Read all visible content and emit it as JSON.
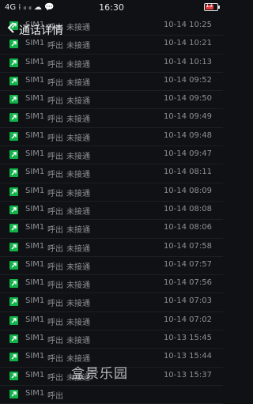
{
  "statusbar": {
    "left_text": "4G ⁞ ᵢₗ ᵢₗ ☁ 💬",
    "time": "16:30",
    "battery": "13"
  },
  "header": {
    "title": "通话详情"
  },
  "rows": [
    {
      "sim": "SIM1",
      "type": "呼出",
      "status": "未接通",
      "time": "10-14 10:25"
    },
    {
      "sim": "SIM1",
      "type": "呼出",
      "status": "未接通",
      "time": "10-14 10:21"
    },
    {
      "sim": "SIM1",
      "type": "呼出",
      "status": "未接通",
      "time": "10-14 10:13"
    },
    {
      "sim": "SIM1",
      "type": "呼出",
      "status": "未接通",
      "time": "10-14 09:52"
    },
    {
      "sim": "SIM1",
      "type": "呼出",
      "status": "未接通",
      "time": "10-14 09:50"
    },
    {
      "sim": "SIM1",
      "type": "呼出",
      "status": "未接通",
      "time": "10-14 09:49"
    },
    {
      "sim": "SIM1",
      "type": "呼出",
      "status": "未接通",
      "time": "10-14 09:48"
    },
    {
      "sim": "SIM1",
      "type": "呼出",
      "status": "未接通",
      "time": "10-14 09:47"
    },
    {
      "sim": "SIM1",
      "type": "呼出",
      "status": "未接通",
      "time": "10-14 08:11"
    },
    {
      "sim": "SIM1",
      "type": "呼出",
      "status": "未接通",
      "time": "10-14 08:09"
    },
    {
      "sim": "SIM1",
      "type": "呼出",
      "status": "未接通",
      "time": "10-14 08:08"
    },
    {
      "sim": "SIM1",
      "type": "呼出",
      "status": "未接通",
      "time": "10-14 08:06"
    },
    {
      "sim": "SIM1",
      "type": "呼出",
      "status": "未接通",
      "time": "10-14 07:58"
    },
    {
      "sim": "SIM1",
      "type": "呼出",
      "status": "未接通",
      "time": "10-14 07:57"
    },
    {
      "sim": "SIM1",
      "type": "呼出",
      "status": "未接通",
      "time": "10-14 07:56"
    },
    {
      "sim": "SIM1",
      "type": "呼出",
      "status": "未接通",
      "time": "10-14 07:03"
    },
    {
      "sim": "SIM1",
      "type": "呼出",
      "status": "未接通",
      "time": "10-14 07:02"
    },
    {
      "sim": "SIM1",
      "type": "呼出",
      "status": "未接通",
      "time": "10-13 15:45"
    },
    {
      "sim": "SIM1",
      "type": "呼出",
      "status": "未接通",
      "time": "10-13 15:44"
    },
    {
      "sim": "SIM1",
      "type": "呼出",
      "status": "未接通",
      "time": "10-13 15:37"
    },
    {
      "sim": "SIM1",
      "type": "呼出",
      "status": "",
      "time": ""
    }
  ],
  "watermark": "盒景乐园",
  "icon_color": "#12b24a"
}
